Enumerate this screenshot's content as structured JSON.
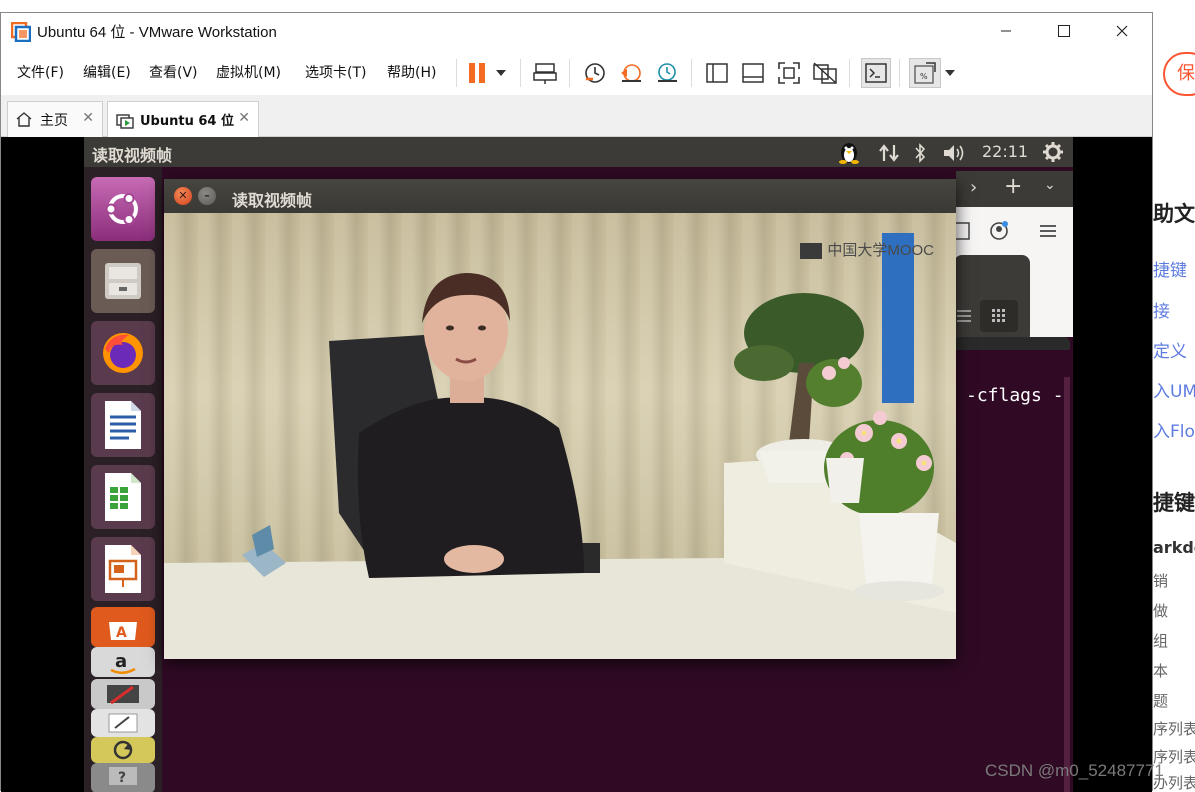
{
  "top_strip": {
    "text": "...b..../.../..../...."
  },
  "window": {
    "title": "Ubuntu 64 位 - VMware Workstation",
    "minimize": "—",
    "maximize": "☐",
    "close": "✕"
  },
  "menu": {
    "items": [
      "文件(F)",
      "编辑(E)",
      "查看(V)",
      "虚拟机(M)",
      "选项卡(T)",
      "帮助(H)"
    ]
  },
  "tabs": [
    {
      "label": "主页",
      "icon": "home-icon"
    },
    {
      "label": "Ubuntu 64 位",
      "icon": "vm-play-icon"
    }
  ],
  "ubuntu": {
    "panel_title": "读取视频帧",
    "clock": "22:11",
    "launcher": [
      "ubuntu-dash",
      "files",
      "firefox",
      "libreoffice-writer",
      "libreoffice-calc",
      "libreoffice-impress",
      "software-center",
      "amazon",
      "system-settings",
      "text-editor",
      "update-manager",
      "help"
    ]
  },
  "video_window": {
    "title": "读取视频帧",
    "watermark": "中国大学MOOC"
  },
  "terminal": {
    "text": "-cflags -"
  },
  "background_page": {
    "publish_btn": "保",
    "lines": [
      "助文",
      "捷键",
      "接",
      "定义",
      "入UM",
      "入Flo",
      "捷键",
      "arkdo",
      "销",
      "做",
      "组",
      "本",
      "题",
      "序列表",
      "序列表",
      "办列表"
    ]
  },
  "csdn_watermark": "CSDN @m0_52487771",
  "colors": {
    "ubuntu_purple": "#300a24",
    "unity_panel": "#3c3b37",
    "vmware_pause": "#f26b21",
    "csdn_orange": "#fc5531"
  }
}
